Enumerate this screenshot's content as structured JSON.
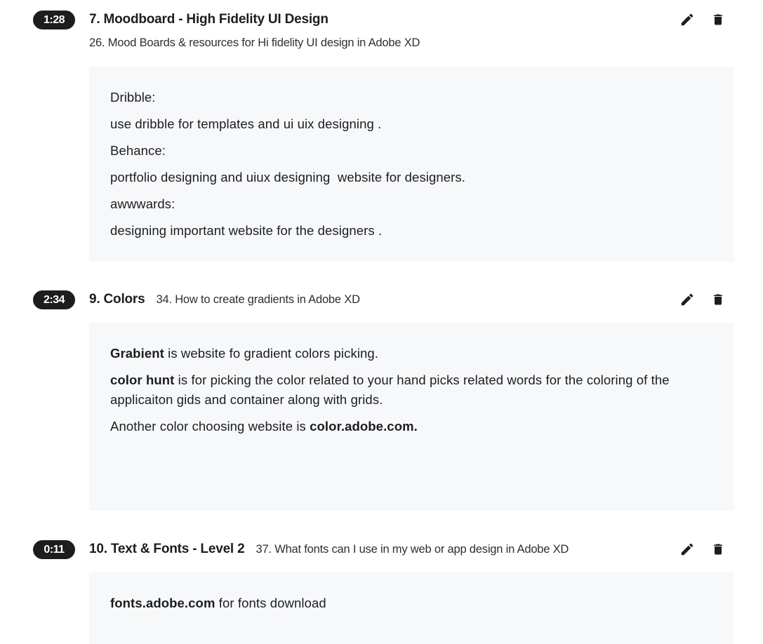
{
  "notes": [
    {
      "timestamp": "1:28",
      "section": "7. Moodboard - High Fidelity UI Design",
      "lecture": "26. Mood Boards & resources for Hi fidelity UI design in Adobe XD",
      "body": [
        [
          {
            "text": "Dribble:",
            "bold": false
          }
        ],
        [
          {
            "text": "use dribble for templates and ui uix designing .",
            "bold": false
          }
        ],
        [
          {
            "text": "Behance:",
            "bold": false
          }
        ],
        [
          {
            "text": "portfolio designing and uiux designing  website for designers.",
            "bold": false
          }
        ],
        [
          {
            "text": "awwwards:",
            "bold": false
          }
        ],
        [
          {
            "text": "designing important website for the designers .",
            "bold": false
          }
        ]
      ]
    },
    {
      "timestamp": "2:34",
      "section": "9. Colors",
      "lecture": "34. How to create gradients in Adobe XD",
      "body": [
        [
          {
            "text": "Grabient",
            "bold": true
          },
          {
            "text": " is website fo gradient colors picking.",
            "bold": false
          }
        ],
        [
          {
            "text": "color hunt",
            "bold": true
          },
          {
            "text": " is for picking the color related to your hand picks related words for the coloring of the applicaiton gids and container along with grids.",
            "bold": false
          }
        ],
        [
          {
            "text": "Another color choosing website is ",
            "bold": false
          },
          {
            "text": "color.adobe.com.",
            "bold": true
          }
        ]
      ]
    },
    {
      "timestamp": "0:11",
      "section": "10. Text & Fonts - Level 2",
      "lecture": "37. What fonts can I use in my web or app design in Adobe XD",
      "body": [
        [
          {
            "text": "fonts.adobe.com",
            "bold": true
          },
          {
            "text": " for fonts download",
            "bold": false
          }
        ]
      ]
    }
  ],
  "icons": {
    "edit": "pencil-icon",
    "delete": "trash-icon"
  },
  "colors": {
    "badge_bg": "#1c1d1f",
    "content_bg": "#f7f8fa",
    "text": "#1c1d1f"
  }
}
